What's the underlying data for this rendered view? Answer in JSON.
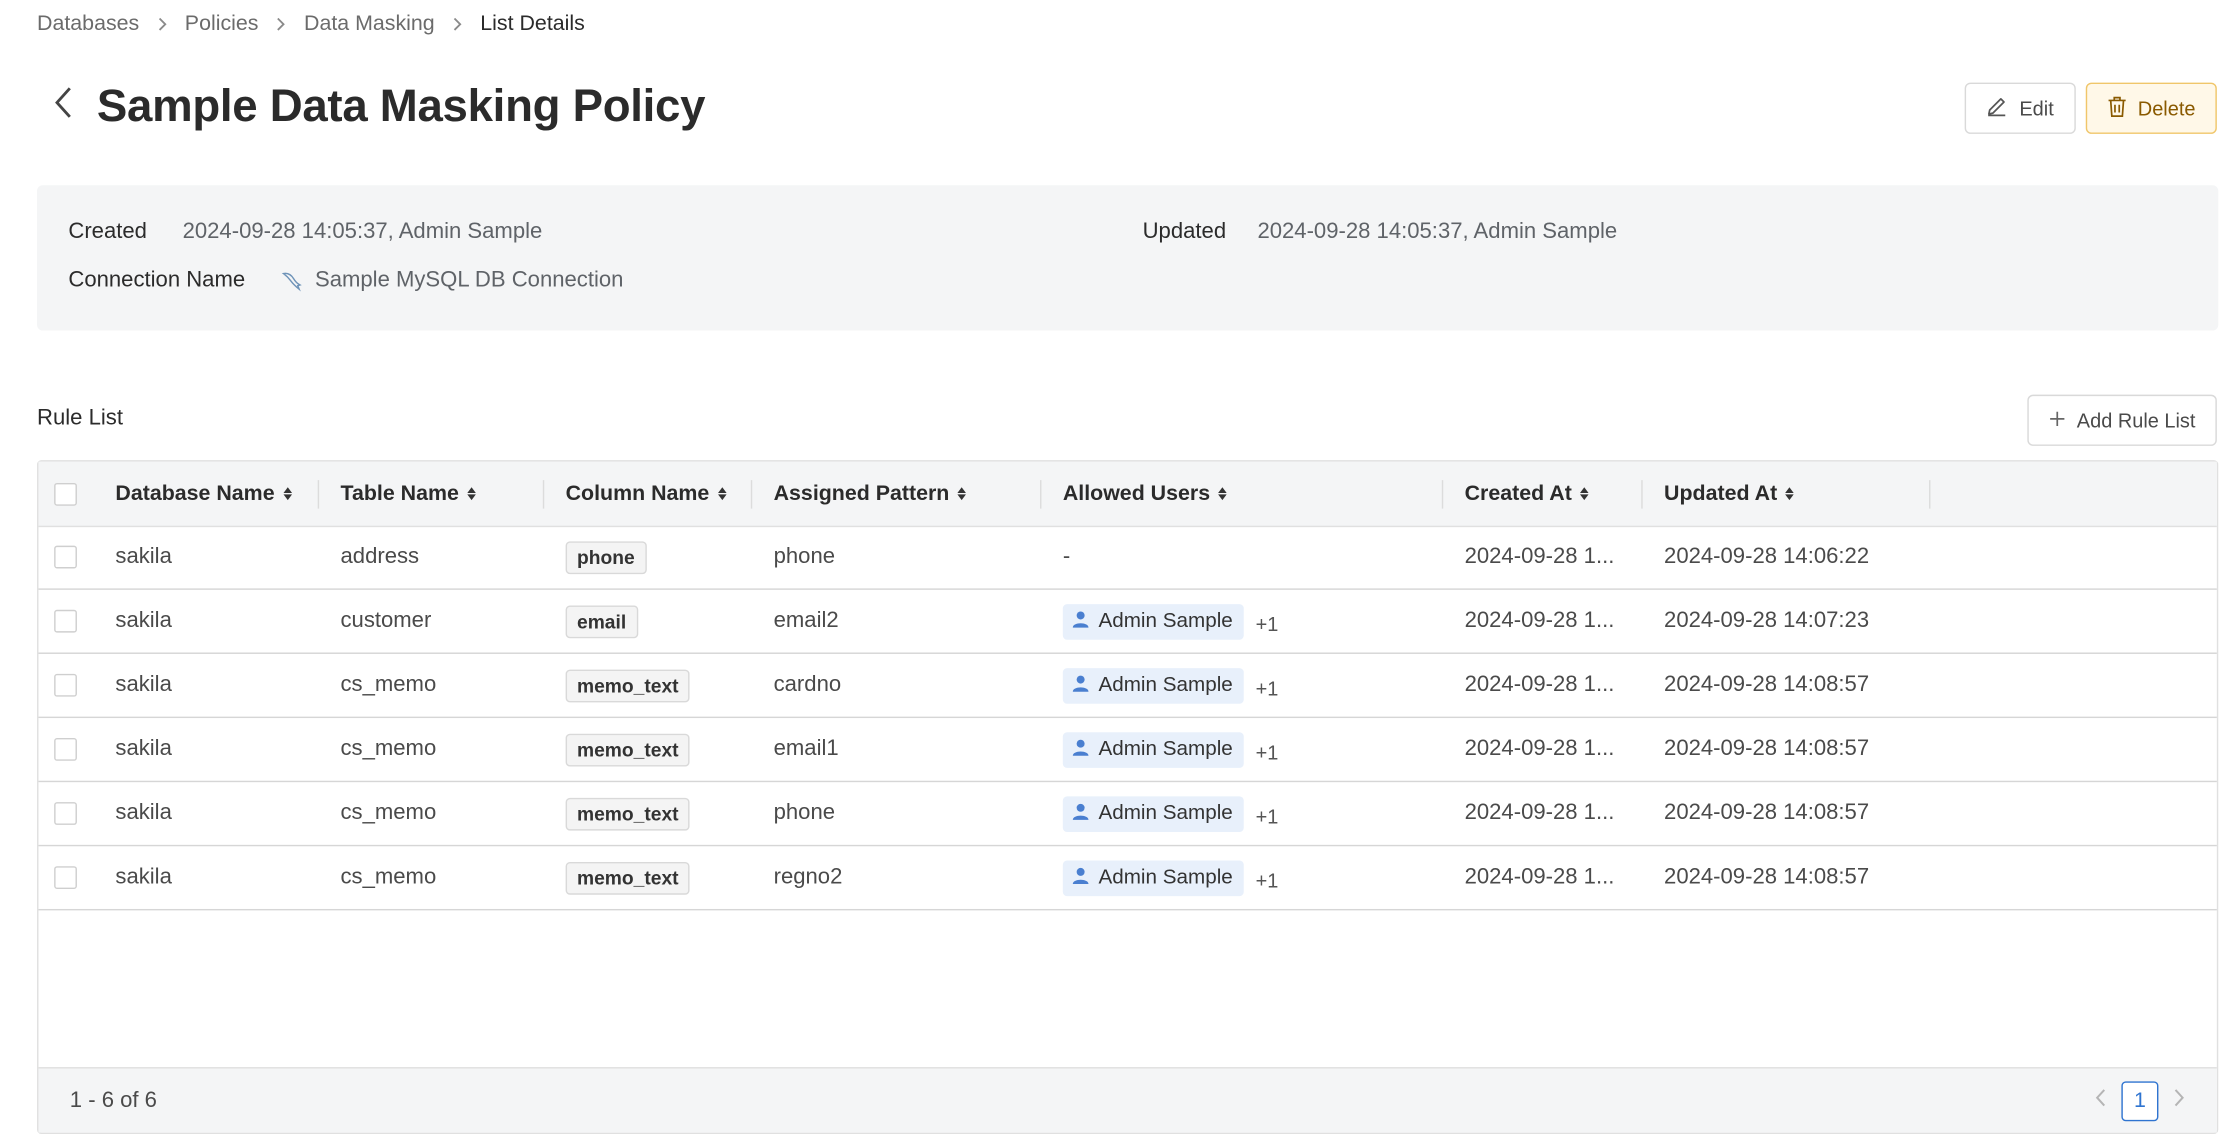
{
  "breadcrumb": {
    "items": [
      "Databases",
      "Policies",
      "Data Masking"
    ],
    "current": "List Details"
  },
  "header": {
    "title": "Sample Data Masking Policy",
    "edit_label": "Edit",
    "delete_label": "Delete"
  },
  "info": {
    "created_label": "Created",
    "created_value": "2024-09-28 14:05:37, Admin Sample",
    "updated_label": "Updated",
    "updated_value": "2024-09-28 14:05:37, Admin Sample",
    "connection_label": "Connection Name",
    "connection_value": "Sample MySQL DB Connection"
  },
  "rules": {
    "section_title": "Rule List",
    "add_label": "Add Rule List",
    "columns": [
      "Database Name",
      "Table Name",
      "Column Name",
      "Assigned Pattern",
      "Allowed Users",
      "Created At",
      "Updated At"
    ],
    "rows": [
      {
        "db": "sakila",
        "table": "address",
        "column": "phone",
        "pattern": "phone",
        "users": "-",
        "more": "",
        "created": "2024-09-28 1...",
        "updated": "2024-09-28 14:06:22"
      },
      {
        "db": "sakila",
        "table": "customer",
        "column": "email",
        "pattern": "email2",
        "users": "Admin Sample",
        "more": "+1",
        "created": "2024-09-28 1...",
        "updated": "2024-09-28 14:07:23"
      },
      {
        "db": "sakila",
        "table": "cs_memo",
        "column": "memo_text",
        "pattern": "cardno",
        "users": "Admin Sample",
        "more": "+1",
        "created": "2024-09-28 1...",
        "updated": "2024-09-28 14:08:57"
      },
      {
        "db": "sakila",
        "table": "cs_memo",
        "column": "memo_text",
        "pattern": "email1",
        "users": "Admin Sample",
        "more": "+1",
        "created": "2024-09-28 1...",
        "updated": "2024-09-28 14:08:57"
      },
      {
        "db": "sakila",
        "table": "cs_memo",
        "column": "memo_text",
        "pattern": "phone",
        "users": "Admin Sample",
        "more": "+1",
        "created": "2024-09-28 1...",
        "updated": "2024-09-28 14:08:57"
      },
      {
        "db": "sakila",
        "table": "cs_memo",
        "column": "memo_text",
        "pattern": "regno2",
        "users": "Admin Sample",
        "more": "+1",
        "created": "2024-09-28 1...",
        "updated": "2024-09-28 14:08:57"
      }
    ],
    "count_text": "1 - 6 of 6",
    "current_page": "1"
  },
  "icons": {
    "back": "chevron-left-icon",
    "edit": "pencil-icon",
    "delete": "trash-icon",
    "connection": "mysql-dolphin-icon",
    "add": "plus-icon",
    "user": "user-icon",
    "sort": "sort-icon"
  },
  "colors": {
    "accent": "#2f74d0",
    "danger_bg": "#fff8e8",
    "danger_border": "#f0c66a",
    "panel_bg": "#f4f5f6",
    "user_chip_bg": "#e8f0fb"
  }
}
